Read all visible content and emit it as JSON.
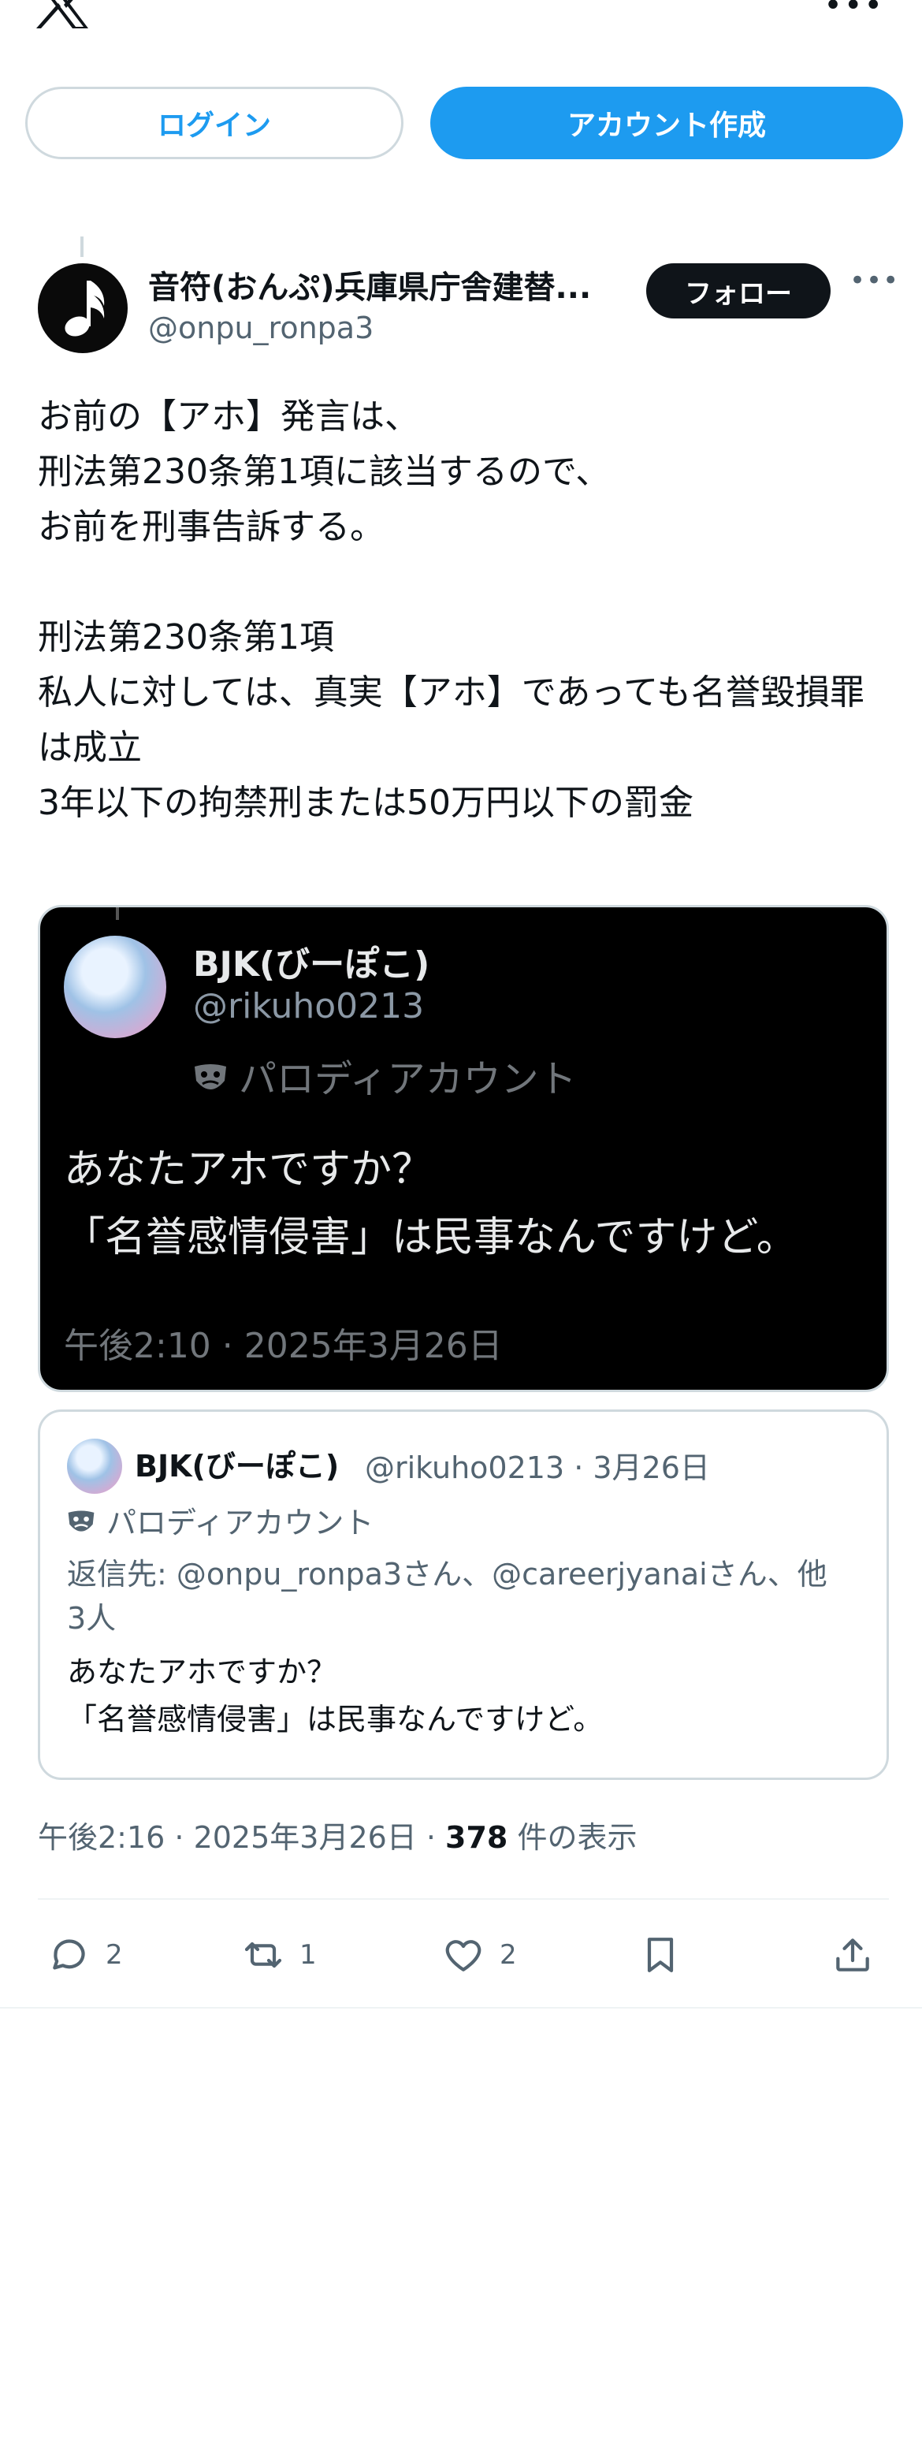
{
  "topbar": {
    "logo_icon": "x-logo-icon",
    "more_icon": "more-icon",
    "more_glyph": "•••"
  },
  "auth": {
    "login_label": "ログイン",
    "signup_label": "アカウント作成"
  },
  "post": {
    "author_name": "音符(おんぷ)兵庫県庁舎建替...",
    "author_handle": "@onpu_ronpa3",
    "follow_label": "フォロー",
    "more_glyph": "•••",
    "text": "お前の【アホ】発言は、\n刑法第230条第1項に該当するので、\nお前を刑事告訴する。\n\n刑法第230条第1項\n私人に対しては、真実【アホ】であっても名誉毀損罪は成立\n3年以下の拘禁刑または50万円以下の罰金",
    "timestamp": "午後2:16 · 2025年3月26日 · ",
    "views_count": "378",
    "views_label": " 件の表示"
  },
  "media": {
    "name": "BJK(びーぽこ)",
    "handle": "@rikuho0213",
    "parody_label": "パロディアカウント",
    "text": "あなたアホですか？\n「名誉感情侵害」は民事なんですけど。",
    "time": "午後2:10 · 2025年3月26日"
  },
  "quote": {
    "name": "BJK(びーぽこ)",
    "meta": "@rikuho0213 · 3月26日",
    "parody_label": "パロディアカウント",
    "reply_to": "返信先: @onpu_ronpa3さん、@careerjyanaiさん、他3人",
    "text": "あなたアホですか？\n「名誉感情侵害」は民事なんですけど。"
  },
  "actions": {
    "reply_count": "2",
    "retweet_count": "1",
    "like_count": "2"
  },
  "colors": {
    "accent": "#1d9bf0",
    "text": "#0f1419",
    "muted": "#536471",
    "border": "#cfd9de"
  }
}
